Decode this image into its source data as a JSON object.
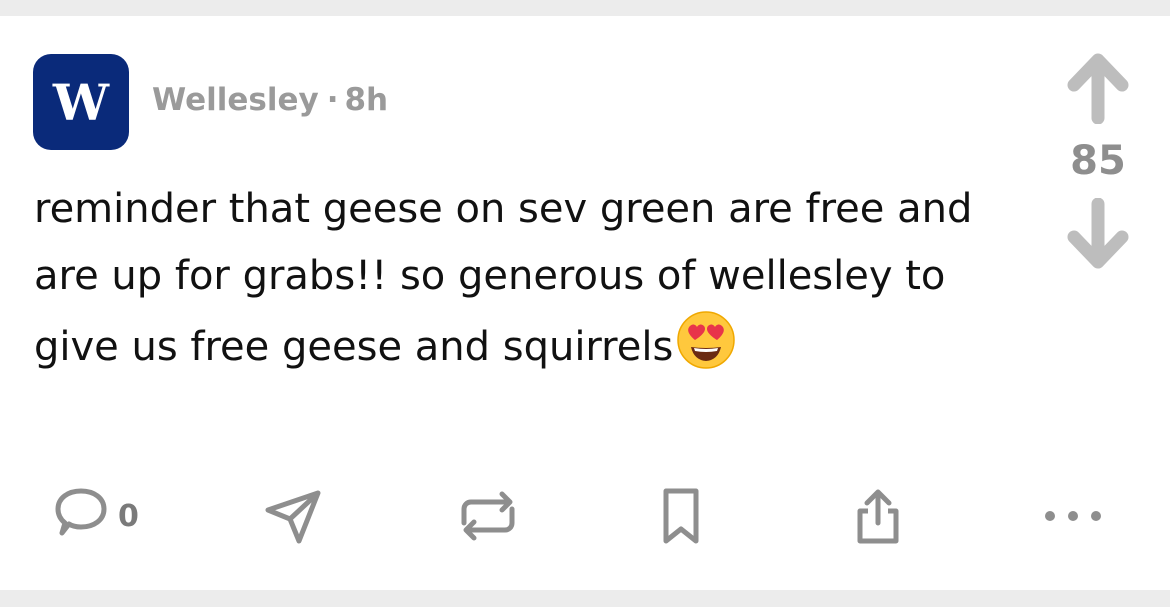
{
  "post": {
    "avatar_letter": "W",
    "author": "Wellesley",
    "separator": "·",
    "time": "8h",
    "text": "reminder that geese on sev green are free and are up for grabs!! so generous of wellesley to give us free geese and squirrels",
    "emoji": "smiling-face-with-heart-eyes"
  },
  "votes": {
    "count": "85"
  },
  "actions": {
    "comment_count": "0",
    "icons": [
      "comment-icon",
      "share-send-icon",
      "repost-icon",
      "bookmark-icon",
      "upload-share-icon",
      "more-icon"
    ]
  },
  "colors": {
    "avatar_bg": "#0a2a7a",
    "icon_gray": "#8e8e8e",
    "text": "#111111",
    "meta_text": "#9a9a9a"
  }
}
